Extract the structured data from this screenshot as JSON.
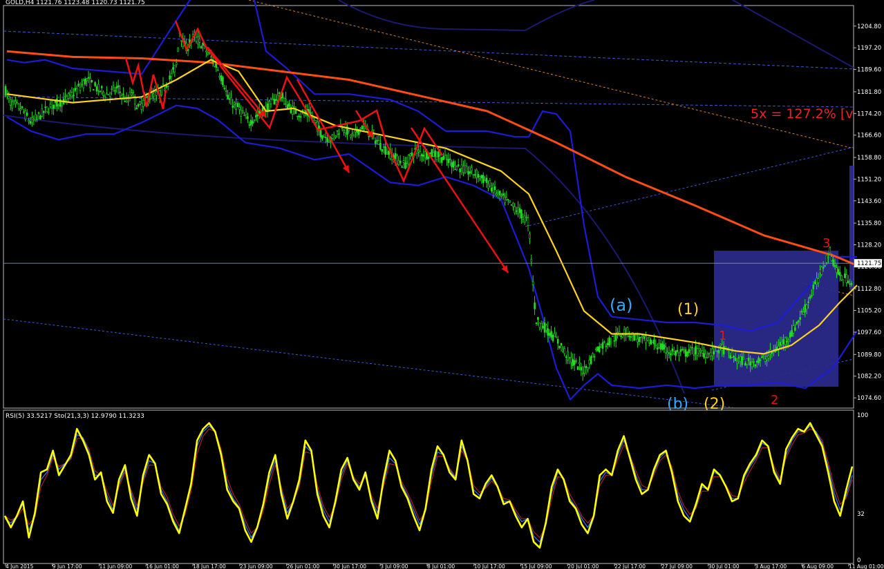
{
  "chart_data": [
    {
      "type": "line",
      "title": "GOLD,H4  1121.76 1123.48 1120.73 1121.75",
      "symbol": "GOLD",
      "timeframe": "H4",
      "ohlc": [
        1121.76,
        1123.48,
        1120.73,
        1121.75
      ],
      "ylim": [
        1071.0,
        1212.0
      ],
      "y_ticks": [
        "1204.80",
        "1197.20",
        "1189.60",
        "1181.80",
        "1174.20",
        "1166.60",
        "1158.80",
        "1151.20",
        "1143.60",
        "1135.80",
        "1128.20",
        "1120.60",
        "1112.80",
        "1105.20",
        "1097.60",
        "1089.80",
        "1082.20",
        "1074.60"
      ],
      "current_price": "1121.75",
      "x_ticks": [
        "4 Jun 2015",
        "9 Jun 17:00",
        "11 Jun 09:00",
        "16 Jun 01:00",
        "18 Jun 17:00",
        "23 Jun 09:00",
        "26 Jun 01:00",
        "30 Jun 17:00",
        "3 Jul 09:00",
        "8 Jul 01:00",
        "10 Jul 17:00",
        "15 Jul 09:00",
        "20 Jul 01:00",
        "22 Jul 17:00",
        "27 Jul 09:00",
        "30 Jul 01:00",
        "3 Aug 17:00",
        "6 Aug 09:00",
        "11 Aug 01:00"
      ],
      "colors": {
        "candles": "#22dd22",
        "ema_slow": "#ff4d14",
        "ema_fast": "#ffd21c",
        "bollinger": "#1c1cd6",
        "channel": "#1a1a70",
        "arrows": "#ee1111",
        "box": "#2a2a8a"
      },
      "series": [
        {
          "name": "",
          "role": "price",
          "x": [
            0,
            10,
            25,
            40,
            55,
            70,
            90,
            105,
            120,
            135,
            150,
            165,
            180,
            185,
            195,
            210,
            225,
            240,
            250,
            255,
            260,
            265,
            275,
            285,
            300,
            310,
            320,
            325,
            340,
            355,
            370,
            385,
            400,
            415,
            430,
            445,
            460,
            475,
            490,
            505,
            520,
            535,
            550,
            565,
            580,
            595,
            610,
            625,
            640,
            655,
            670,
            685,
            700,
            715,
            730,
            745,
            760,
            770,
            780,
            800,
            820,
            840,
            860,
            880,
            900,
            920,
            940,
            960,
            980,
            1000,
            1020,
            1040,
            1060,
            1080,
            1100,
            1120,
            1140,
            1160,
            1180,
            1195,
            1210,
            1225,
            1235
          ],
          "values": [
            1184,
            1178,
            1176,
            1171,
            1174,
            1177,
            1179,
            1182,
            1186,
            1183,
            1181,
            1183,
            1178,
            1182,
            1176,
            1180,
            1181,
            1186,
            1191,
            1203,
            1199,
            1197,
            1201,
            1199,
            1194,
            1190,
            1184,
            1179,
            1176,
            1171,
            1174,
            1177,
            1181,
            1176,
            1174,
            1174,
            1167,
            1165,
            1170,
            1166,
            1170,
            1166,
            1162,
            1159,
            1156,
            1161,
            1160,
            1160,
            1158,
            1156,
            1154,
            1153,
            1150,
            1146,
            1143,
            1140,
            1136,
            1102,
            1100,
            1095,
            1088,
            1084,
            1092,
            1095,
            1098,
            1095,
            1094,
            1091,
            1090,
            1091,
            1090,
            1092,
            1088,
            1087,
            1088,
            1092,
            1097,
            1106,
            1117,
            1126,
            1117,
            1116,
            1114
          ]
        },
        {
          "name": "",
          "role": "ema_slow",
          "x": [
            5,
            100,
            200,
            300,
            400,
            500,
            600,
            700,
            800,
            900,
            1000,
            1100,
            1200,
            1235
          ],
          "values": [
            1196,
            1194,
            1193.5,
            1192,
            1189,
            1186,
            1180.5,
            1175,
            1164,
            1152,
            1142,
            1131.5,
            1124.5,
            1121
          ]
        },
        {
          "name": "",
          "role": "ema_fast",
          "x": [
            5,
            100,
            200,
            250,
            300,
            340,
            380,
            420,
            480,
            560,
            640,
            720,
            760,
            800,
            840,
            880,
            920,
            1000,
            1060,
            1100,
            1140,
            1180,
            1210,
            1235
          ],
          "values": [
            1181,
            1178,
            1180,
            1186,
            1193,
            1189,
            1175,
            1176,
            1170,
            1166,
            1162,
            1154,
            1146,
            1126,
            1105,
            1097,
            1097,
            1094,
            1091,
            1090,
            1093,
            1100,
            1108,
            1114
          ]
        },
        {
          "name": "",
          "role": "bollinger_upper",
          "x": [
            5,
            30,
            60,
            100,
            150,
            200,
            240,
            270,
            300,
            330,
            360,
            380,
            410,
            450,
            500,
            560,
            600,
            640,
            700,
            740,
            760,
            780,
            800,
            820,
            840,
            860,
            880,
            920,
            960,
            1000,
            1040,
            1080,
            1120,
            1160,
            1200,
            1235
          ],
          "values": [
            1193,
            1192,
            1193,
            1190,
            1189,
            1188,
            1203,
            1214,
            1218,
            1220,
            1217,
            1196,
            1190,
            1181,
            1181,
            1179,
            1175,
            1168,
            1168,
            1166,
            1166,
            1175,
            1174,
            1168,
            1135,
            1110,
            1103,
            1102,
            1101,
            1101,
            1100,
            1098,
            1101,
            1112,
            1124,
            1124
          ]
        },
        {
          "name": "",
          "role": "bollinger_lower",
          "x": [
            5,
            40,
            80,
            120,
            160,
            200,
            250,
            280,
            310,
            350,
            400,
            450,
            500,
            560,
            600,
            640,
            680,
            720,
            760,
            780,
            800,
            820,
            840,
            860,
            880,
            920,
            960,
            1000,
            1040,
            1080,
            1120,
            1160,
            1200,
            1235
          ],
          "values": [
            1173,
            1168,
            1165,
            1167,
            1167,
            1171,
            1177,
            1176,
            1172,
            1164,
            1162,
            1158,
            1160,
            1150,
            1149,
            1152,
            1149,
            1144,
            1120,
            1103,
            1085,
            1074,
            1079,
            1083,
            1079,
            1078,
            1079,
            1078,
            1079,
            1079,
            1080,
            1078,
            1085,
            1098
          ]
        }
      ],
      "wave_labels": [
        {
          "text": "(a)",
          "color": "#33aaff"
        },
        {
          "text": "(1)",
          "color": "#ffd21c"
        },
        {
          "text": "1",
          "color": "#ee1111"
        },
        {
          "text": "(b)",
          "color": "#33aaff"
        },
        {
          "text": "(2)",
          "color": "#ffd21c"
        },
        {
          "text": "2",
          "color": "#ee1111"
        },
        {
          "text": "3",
          "color": "#ee1111"
        }
      ],
      "fib_label": "5x = 127.2% [v"
    },
    {
      "type": "line",
      "title": "RSI(5) 33.5217  Sto(21,3,3) 12.9790 11.3233",
      "ylim": [
        0,
        100
      ],
      "y_ticks": [
        "100",
        "32",
        "0"
      ],
      "series": [
        {
          "name": "",
          "role": "rsi",
          "color": "#ffff00",
          "values": [
            30,
            22,
            30,
            40,
            15,
            32,
            60,
            62,
            75,
            58,
            65,
            72,
            90,
            82,
            72,
            55,
            60,
            40,
            32,
            55,
            65,
            42,
            30,
            58,
            72,
            66,
            45,
            38,
            26,
            18,
            35,
            52,
            82,
            90,
            94,
            88,
            72,
            48,
            40,
            35,
            20,
            12,
            22,
            38,
            60,
            72,
            45,
            28,
            40,
            55,
            82,
            75,
            45,
            30,
            22,
            40,
            62,
            70,
            55,
            48,
            60,
            40,
            28,
            55,
            75,
            68,
            50,
            42,
            30,
            20,
            35,
            62,
            78,
            72,
            60,
            55,
            82,
            68,
            45,
            42,
            52,
            58,
            50,
            38,
            40,
            30,
            22,
            28,
            12,
            8,
            25,
            50,
            62,
            55,
            40,
            35,
            24,
            18,
            30,
            58,
            62,
            58,
            75,
            85,
            70,
            55,
            45,
            48,
            62,
            72,
            75,
            60,
            40,
            30,
            26,
            38,
            52,
            48,
            62,
            58,
            50,
            40,
            42,
            58,
            66,
            72,
            82,
            78,
            60,
            52,
            76,
            84,
            90,
            88,
            94,
            86,
            78,
            60,
            40,
            30,
            48,
            64
          ]
        },
        {
          "name": "",
          "role": "sto_main",
          "color": "#3a78ff",
          "values": [
            28,
            25,
            30,
            38,
            20,
            30,
            55,
            60,
            72,
            62,
            66,
            70,
            86,
            84,
            74,
            58,
            58,
            44,
            34,
            52,
            62,
            46,
            34,
            55,
            68,
            66,
            48,
            40,
            28,
            20,
            33,
            50,
            78,
            88,
            92,
            88,
            74,
            52,
            42,
            36,
            24,
            15,
            22,
            36,
            56,
            68,
            48,
            32,
            40,
            52,
            78,
            74,
            48,
            34,
            26,
            38,
            58,
            68,
            56,
            50,
            58,
            42,
            32,
            52,
            70,
            66,
            52,
            44,
            34,
            24,
            34,
            58,
            74,
            72,
            62,
            56,
            78,
            68,
            48,
            44,
            50,
            56,
            50,
            40,
            40,
            32,
            26,
            28,
            16,
            12,
            24,
            46,
            60,
            56,
            42,
            36,
            28,
            22,
            30,
            54,
            60,
            58,
            72,
            82,
            72,
            58,
            48,
            48,
            60,
            70,
            74,
            62,
            44,
            34,
            28,
            36,
            50,
            48,
            60,
            58,
            50,
            42,
            42,
            56,
            64,
            70,
            80,
            78,
            62,
            54,
            72,
            82,
            88,
            88,
            92,
            88,
            80,
            64,
            46,
            34,
            44,
            58
          ]
        },
        {
          "name": "",
          "role": "sto_signal",
          "color": "#aa2222",
          "values": [
            30,
            27,
            29,
            35,
            24,
            29,
            50,
            58,
            70,
            64,
            66,
            69,
            83,
            84,
            76,
            61,
            58,
            47,
            37,
            50,
            60,
            48,
            37,
            53,
            65,
            65,
            50,
            43,
            31,
            23,
            31,
            47,
            73,
            85,
            90,
            88,
            76,
            56,
            45,
            38,
            27,
            18,
            22,
            33,
            52,
            65,
            50,
            35,
            40,
            50,
            74,
            73,
            51,
            37,
            29,
            37,
            55,
            66,
            57,
            52,
            57,
            44,
            35,
            50,
            66,
            65,
            54,
            46,
            37,
            27,
            33,
            54,
            71,
            71,
            63,
            57,
            75,
            68,
            51,
            46,
            49,
            54,
            50,
            42,
            41,
            34,
            28,
            28,
            19,
            15,
            23,
            42,
            57,
            56,
            45,
            38,
            30,
            25,
            30,
            51,
            58,
            58,
            69,
            79,
            72,
            61,
            51,
            49,
            58,
            68,
            72,
            64,
            47,
            37,
            31,
            35,
            47,
            47,
            57,
            57,
            51,
            44,
            43,
            53,
            61,
            68,
            77,
            77,
            64,
            56,
            70,
            79,
            86,
            87,
            90,
            88,
            82,
            67,
            50,
            38,
            42,
            55
          ]
        }
      ]
    }
  ]
}
